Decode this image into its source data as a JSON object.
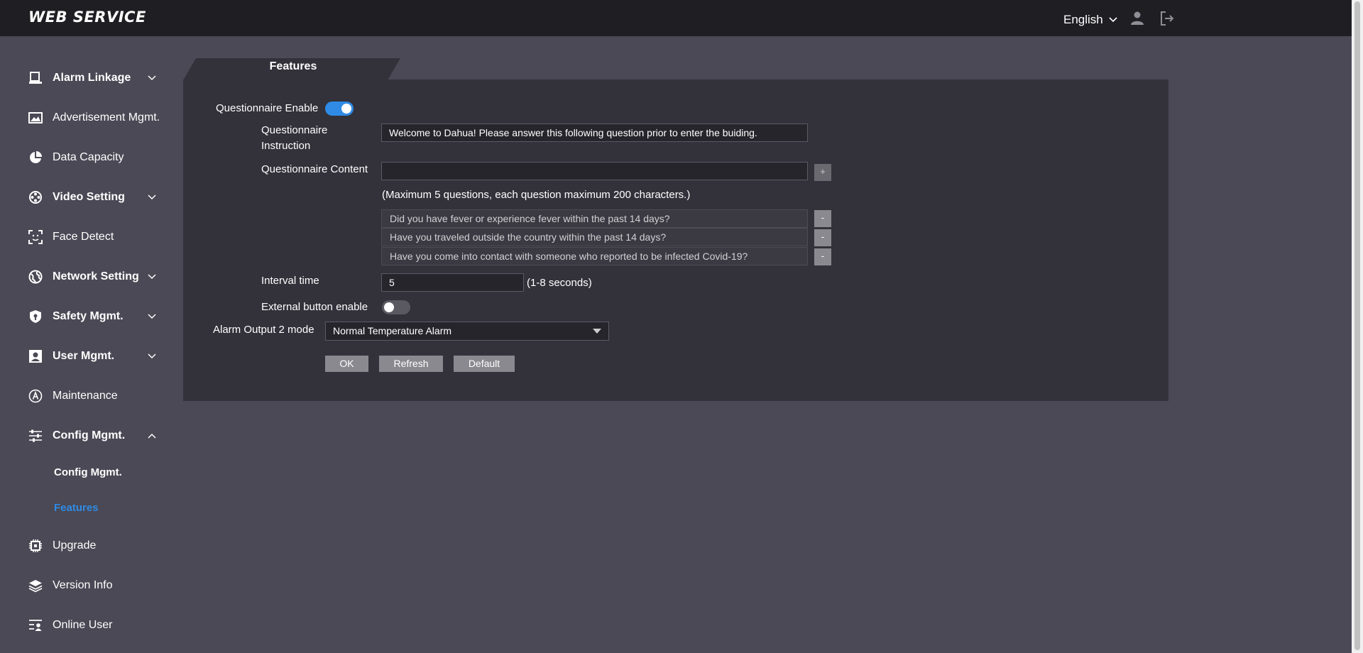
{
  "header": {
    "logo": "WEB SERVICE",
    "language": "English"
  },
  "sidebar": {
    "items": [
      {
        "label": "Alarm Linkage",
        "icon": "alarm-linkage-icon"
      },
      {
        "label": "Advertisement Mgmt.",
        "icon": "image-icon"
      },
      {
        "label": "Data Capacity",
        "icon": "pie-chart-icon"
      },
      {
        "label": "Video Setting",
        "icon": "video-reel-icon"
      },
      {
        "label": "Face Detect",
        "icon": "face-detect-icon"
      },
      {
        "label": "Network Setting",
        "icon": "globe-icon"
      },
      {
        "label": "Safety Mgmt.",
        "icon": "shield-icon"
      },
      {
        "label": "User Mgmt.",
        "icon": "user-card-icon"
      },
      {
        "label": "Maintenance",
        "icon": "maintenance-icon"
      },
      {
        "label": "Config Mgmt.",
        "icon": "sliders-icon"
      },
      {
        "label": "Upgrade",
        "icon": "chip-icon"
      },
      {
        "label": "Version Info",
        "icon": "layers-icon"
      },
      {
        "label": "Online User",
        "icon": "online-user-icon"
      }
    ],
    "sub_items": [
      {
        "label": "Config Mgmt."
      },
      {
        "label": "Features"
      }
    ]
  },
  "tab": {
    "label": "Features"
  },
  "form": {
    "questionnaire_enable_label": "Questionnaire Enable",
    "questionnaire_enable": true,
    "instruction_label_1": "Questionnaire",
    "instruction_label_2": "Instruction",
    "instruction_value": "Welcome to Dahua! Please answer this following question prior to enter the buiding.",
    "content_label": "Questionnaire Content",
    "content_value": "",
    "add_label": "+",
    "limit_note": "(Maximum 5 questions, each question maximum 200 characters.)",
    "questions": [
      "Did you have fever or experience fever within the past 14 days?",
      "Have you traveled outside the country within the past 14 days?",
      "Have you come into contact with someone who reported to be infected Covid-19?"
    ],
    "remove_label": "-",
    "interval_label": "Interval time",
    "interval_value": "5",
    "interval_hint": "(1-8 seconds)",
    "external_button_label": "External button enable",
    "external_button_enable": false,
    "alarm_output_label": "Alarm Output 2 mode",
    "alarm_output_value": "Normal Temperature Alarm",
    "ok_label": "OK",
    "refresh_label": "Refresh",
    "default_label": "Default"
  }
}
